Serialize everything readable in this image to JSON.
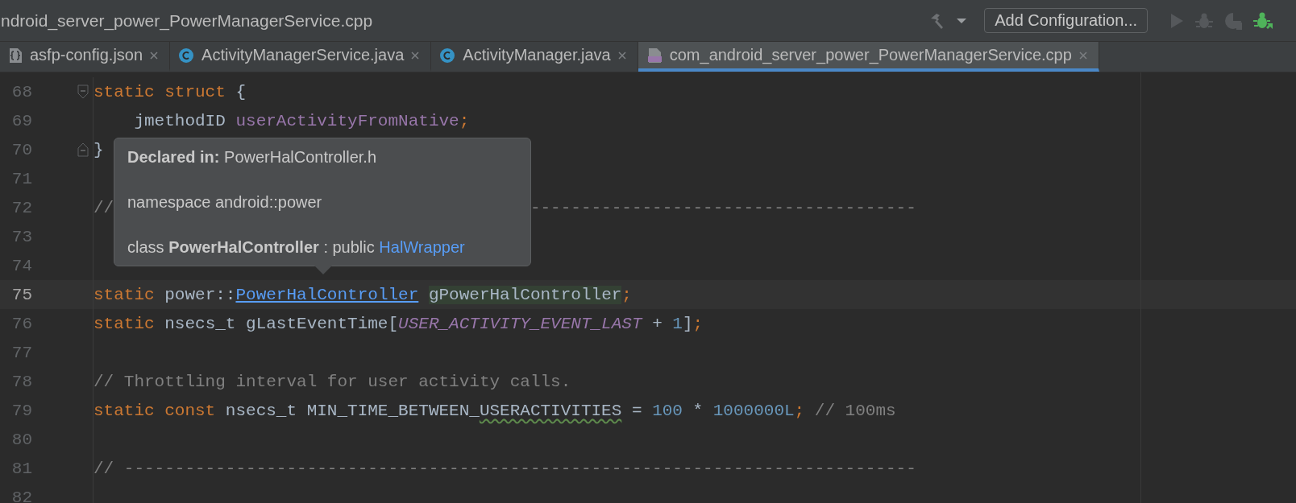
{
  "title_bar": {
    "title": "ndroid_server_power_PowerManagerService.cpp",
    "config_button": "Add Configuration..."
  },
  "tabs": [
    {
      "label": "asfp-config.json",
      "kind": "json",
      "selected": false
    },
    {
      "label": "ActivityManagerService.java",
      "kind": "class",
      "selected": false
    },
    {
      "label": "ActivityManager.java",
      "kind": "class",
      "selected": false
    },
    {
      "label": "com_android_server_power_PowerManagerService.cpp",
      "kind": "cpp",
      "selected": true
    }
  ],
  "editor": {
    "lines": [
      {
        "number": "68",
        "current": false,
        "fold_start": true,
        "fold_end": false,
        "tokens": [
          {
            "text": "static struct",
            "kind": "keyword"
          },
          {
            "text": " {",
            "kind": "plain"
          }
        ]
      },
      {
        "number": "69",
        "current": false,
        "fold_start": false,
        "fold_end": false,
        "tokens": [
          {
            "text": "    jmethodID ",
            "kind": "plain"
          },
          {
            "text": "userActivityFromNative",
            "kind": "field"
          },
          {
            "text": ";",
            "kind": "punct"
          }
        ]
      },
      {
        "number": "70",
        "current": false,
        "fold_start": false,
        "fold_end": true,
        "tokens": [
          {
            "text": "}",
            "kind": "plain"
          }
        ]
      },
      {
        "number": "71",
        "current": false,
        "fold_start": false,
        "fold_end": false
      },
      {
        "number": "72",
        "current": false,
        "fold_start": false,
        "fold_end": false,
        "tokens": [
          {
            "text": "//",
            "kind": "comment",
            "gap_before": false
          },
          {
            "text": "--------------------------------------",
            "kind": "comment",
            "gap_before": true
          }
        ]
      },
      {
        "number": "73",
        "current": false,
        "fold_start": false,
        "fold_end": false
      },
      {
        "number": "74",
        "current": false,
        "fold_start": false,
        "fold_end": false
      },
      {
        "number": "75",
        "current": true,
        "fold_start": false,
        "fold_end": false,
        "tokens": [
          {
            "text": "static",
            "kind": "keyword"
          },
          {
            "text": " power::",
            "kind": "plain"
          },
          {
            "text": "PowerHalController",
            "kind": "link"
          },
          {
            "text": "gPowerHalController",
            "kind": "usage"
          },
          {
            "text": ";",
            "kind": "punct"
          }
        ]
      },
      {
        "number": "76",
        "current": false,
        "fold_start": false,
        "fold_end": false,
        "tokens": [
          {
            "text": "static",
            "kind": "keyword"
          },
          {
            "text": " nsecs_t gLastEventTime[",
            "kind": "plain"
          },
          {
            "text": "USER_ACTIVITY_EVENT_LAST",
            "kind": "macro"
          },
          {
            "text": " + ",
            "kind": "plain"
          },
          {
            "text": "1",
            "kind": "number"
          },
          {
            "text": "]",
            "kind": "plain"
          },
          {
            "text": ";",
            "kind": "punct"
          }
        ]
      },
      {
        "number": "77",
        "current": false,
        "fold_start": false,
        "fold_end": false
      },
      {
        "number": "78",
        "current": false,
        "fold_start": false,
        "fold_end": false,
        "tokens": [
          {
            "text": "// Throttling interval for user activity calls.",
            "kind": "comment"
          }
        ]
      },
      {
        "number": "79",
        "current": false,
        "fold_start": false,
        "fold_end": false,
        "tokens": [
          {
            "text": "static const",
            "kind": "keyword"
          },
          {
            "text": " nsecs_t MIN_TIME_BETWEEN_",
            "kind": "plain"
          },
          {
            "text": "USERACTIVITIES",
            "kind": "typo"
          },
          {
            "text": " = ",
            "kind": "plain"
          },
          {
            "text": "100",
            "kind": "number"
          },
          {
            "text": " * ",
            "kind": "plain"
          },
          {
            "text": "1000000L",
            "kind": "number"
          },
          {
            "text": ";",
            "kind": "punct"
          },
          {
            "text": " // 100ms",
            "kind": "comment"
          }
        ]
      },
      {
        "number": "80",
        "current": false,
        "fold_start": false,
        "fold_end": false
      },
      {
        "number": "81",
        "current": false,
        "fold_start": false,
        "fold_end": false,
        "tokens": [
          {
            "text": "// ------------------------------------------------------------------------------",
            "kind": "comment"
          }
        ]
      },
      {
        "number": "82",
        "current": false,
        "fold_start": false,
        "fold_end": false
      }
    ]
  },
  "popup": {
    "declared": "**Declared in:** PowerHalController.h",
    "namespace": "namespace android::power",
    "class_line": "class **PowerHalController** : public",
    "base_link": "HalWrapper"
  }
}
